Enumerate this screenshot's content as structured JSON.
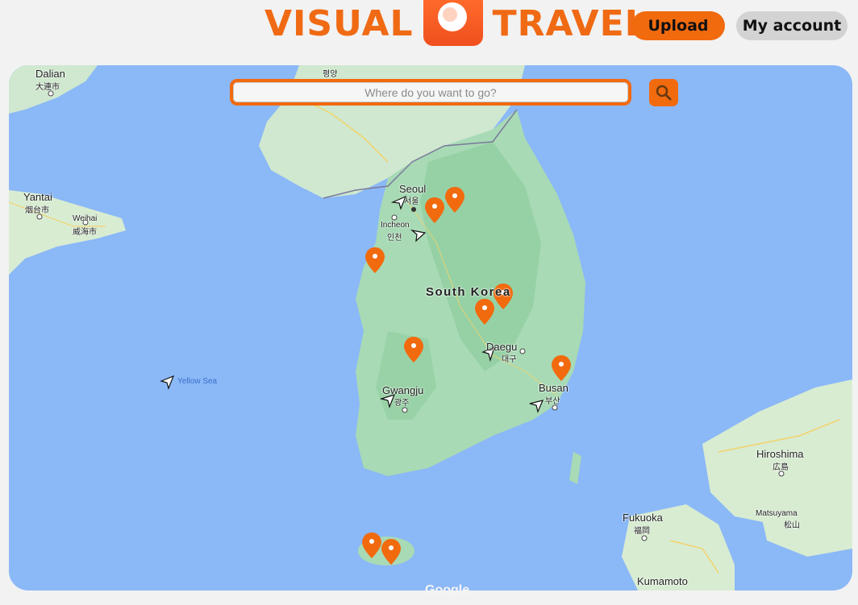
{
  "header": {
    "logo_left": "VISUAL",
    "logo_right": "TRAVEL",
    "logo_icon": "camera-icon",
    "upload_label": "Upload",
    "account_label": "My account"
  },
  "search": {
    "placeholder": "Where do you want to go?",
    "button_icon": "search-icon"
  },
  "map": {
    "labels": {
      "dalian": "Dalian",
      "dalian_local": "大連市",
      "yantai": "Yantai",
      "yantai_local": "烟台市",
      "weihai": "Weihai",
      "weihai_local": "威海市",
      "pyongyang_local": "평양",
      "seoul": "Seoul",
      "seoul_local": "서울",
      "incheon": "Incheon",
      "incheon_local": "인천",
      "south_korea": "South Korea",
      "daegu": "Daegu",
      "daegu_local": "대구",
      "gwangju": "Gwangju",
      "gwangju_local": "광주",
      "busan": "Busan",
      "busan_local": "부산",
      "yellow_sea": "Yellow Sea",
      "hiroshima": "Hiroshima",
      "hiroshima_local": "広島",
      "matsuyama": "Matsuyama",
      "matsuyama_local": "松山",
      "fukuoka": "Fukuoka",
      "fukuoka_local": "福岡",
      "kumamoto": "Kumamoto",
      "google": "Google"
    },
    "pin_color": "#f26a0e",
    "land_color": "#a8dab5",
    "water_color": "#8bb8f7"
  }
}
